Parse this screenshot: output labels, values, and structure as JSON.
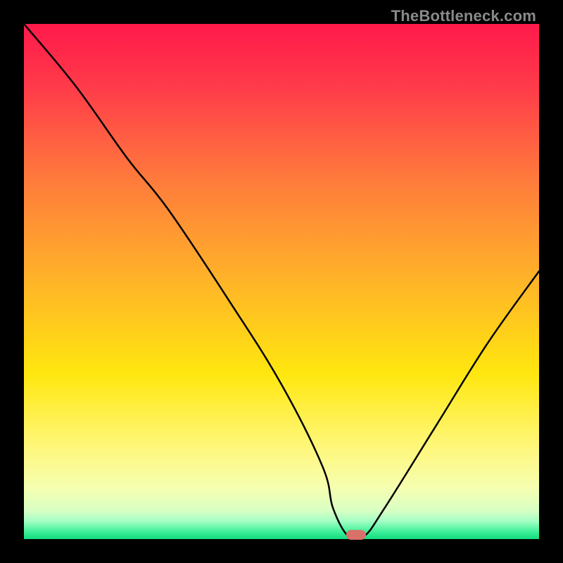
{
  "watermark": "TheBottleneck.com",
  "colors": {
    "marker": "#d9716a",
    "curve": "#000000"
  },
  "chart_data": {
    "type": "line",
    "title": "",
    "xlabel": "",
    "ylabel": "",
    "xlim": [
      0,
      100
    ],
    "ylim": [
      0,
      100
    ],
    "grid": false,
    "legend": false,
    "series": [
      {
        "name": "bottleneck-curve",
        "x": [
          0,
          10,
          20,
          28,
          40,
          50,
          58,
          60,
          63,
          66,
          70,
          80,
          90,
          100
        ],
        "values": [
          100,
          88,
          74,
          64,
          46,
          30,
          14,
          6,
          0.5,
          0.5,
          6,
          22,
          38,
          52
        ]
      }
    ],
    "marker": {
      "x": 64.5,
      "y": 0.8
    }
  }
}
